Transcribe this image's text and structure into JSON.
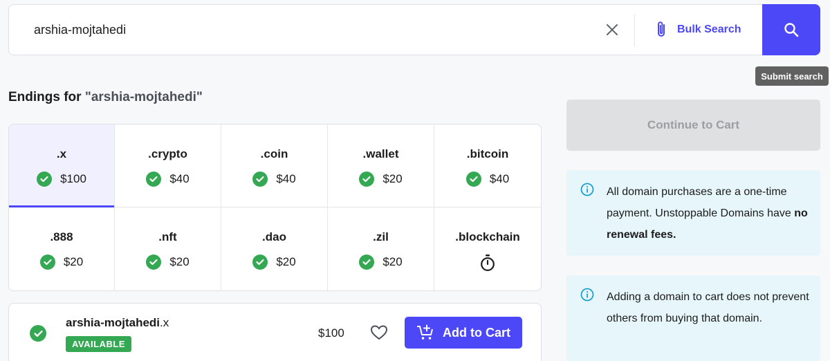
{
  "search": {
    "value": "arshia-mojtahedi",
    "bulk_label": "Bulk Search",
    "tooltip": "Submit search"
  },
  "endings": {
    "title_prefix": "Endings for ",
    "title_query": "\"arshia-mojtahedi\"",
    "items": [
      {
        "ext": ".x",
        "price": "$100",
        "status": "available",
        "selected": true
      },
      {
        "ext": ".crypto",
        "price": "$40",
        "status": "available"
      },
      {
        "ext": ".coin",
        "price": "$40",
        "status": "available"
      },
      {
        "ext": ".wallet",
        "price": "$20",
        "status": "available"
      },
      {
        "ext": ".bitcoin",
        "price": "$40",
        "status": "available"
      },
      {
        "ext": ".888",
        "price": "$20",
        "status": "available"
      },
      {
        "ext": ".nft",
        "price": "$20",
        "status": "available"
      },
      {
        "ext": ".dao",
        "price": "$20",
        "status": "available"
      },
      {
        "ext": ".zil",
        "price": "$20",
        "status": "available"
      },
      {
        "ext": ".blockchain",
        "price": "",
        "status": "pending"
      }
    ]
  },
  "result": {
    "name": "arshia-mojtahedi",
    "ext": ".x",
    "badge": "AVAILABLE",
    "price": "$100",
    "add_label": "Add to Cart"
  },
  "sidebar": {
    "continue_label": "Continue to Cart",
    "info1_text": "All domain purchases are a one-time payment. Unstoppable Domains have ",
    "info1_bold": "no renewal fees.",
    "info2_text": "Adding a domain to cart does not prevent others from buying that domain."
  },
  "colors": {
    "accent": "#4c47f7",
    "success": "#34a853",
    "info_bg": "#e7f6fb",
    "info_icon": "#1a9fd0"
  }
}
